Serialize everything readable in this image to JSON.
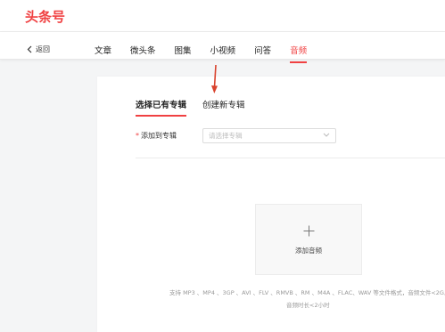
{
  "header": {
    "logo": "头条号"
  },
  "nav": {
    "back_label": "返回",
    "tabs": [
      {
        "label": "文章",
        "active": false
      },
      {
        "label": "微头条",
        "active": false
      },
      {
        "label": "图集",
        "active": false
      },
      {
        "label": "小视频",
        "active": false
      },
      {
        "label": "问答",
        "active": false
      },
      {
        "label": "音频",
        "active": true
      }
    ]
  },
  "album": {
    "tabs": [
      {
        "label": "选择已有专辑",
        "active": true
      },
      {
        "label": "创建新专辑",
        "active": false
      }
    ],
    "field_required_mark": "*",
    "field_label": "添加到专辑",
    "select_placeholder": "请选择专辑"
  },
  "upload": {
    "plus_icon": "plus-icon",
    "label": "添加音频",
    "hint_line1": "支持 MP3 、MP4 、3GP 、AVI 、FLV 、RMVB 、RM 、M4A 、FLAC、WAV 等文件格式，音频文件<2G,",
    "hint_line2": "音频时长<2小时"
  },
  "colors": {
    "accent": "#f04142",
    "annotation_arrow": "#d9432e"
  }
}
